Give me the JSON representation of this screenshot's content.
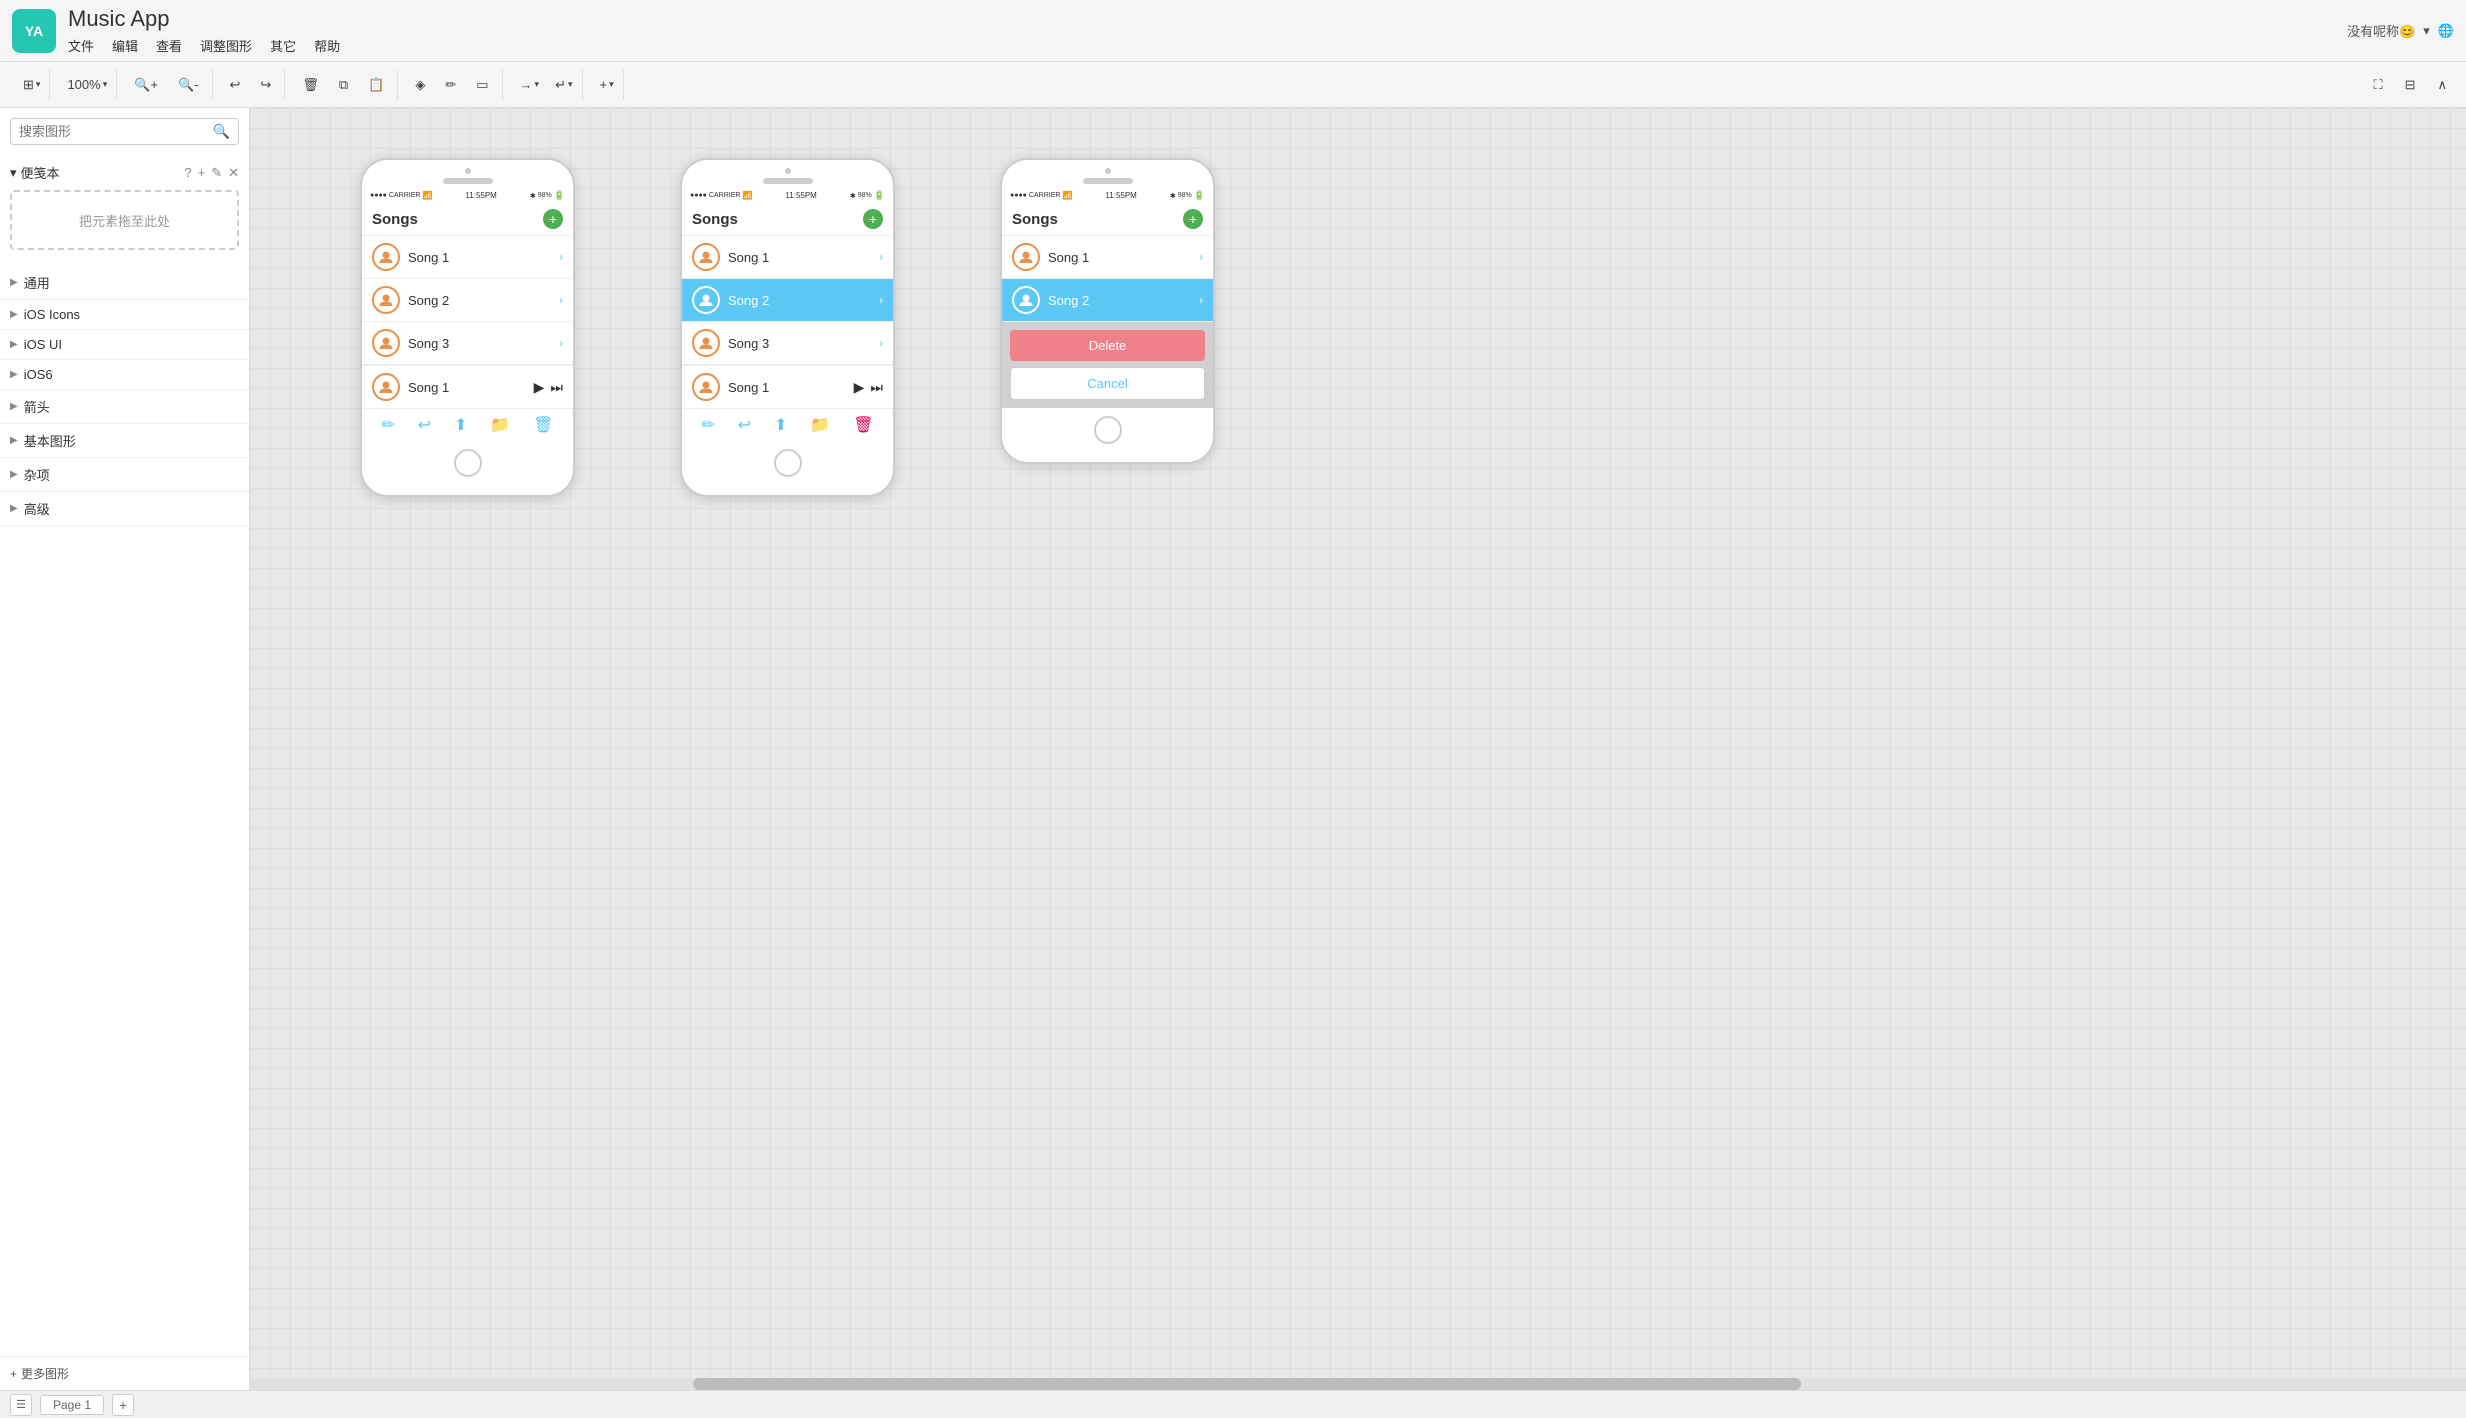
{
  "app": {
    "logo": "YA",
    "title": "Music App",
    "menu": [
      "文件",
      "编辑",
      "查看",
      "调整图形",
      "其它",
      "帮助"
    ],
    "top_right": "没有呢称😊"
  },
  "toolbar": {
    "zoom_level": "100%",
    "add_label": "+",
    "arrow_labels": [
      "→",
      "↵",
      "+"
    ]
  },
  "sidebar": {
    "search_placeholder": "搜索图形",
    "stencil_title": "便笺本",
    "drop_zone_text": "把元素拖至此处",
    "categories": [
      "通用",
      "iOS Icons",
      "iOS UI",
      "iOS6",
      "箭头",
      "基本图形",
      "杂项",
      "高级"
    ]
  },
  "phones": [
    {
      "id": "phone1",
      "status_left": "●●●● CARRIER",
      "status_wifi": "WiFi",
      "status_time": "11:55PM",
      "status_bt": "BT",
      "status_battery": "98%",
      "title": "Songs",
      "songs": [
        "Song 1",
        "Song 2",
        "Song 3"
      ],
      "now_playing": "Song 1",
      "selected_song": null,
      "show_actions": false
    },
    {
      "id": "phone2",
      "status_left": "●●●● CARRIER",
      "status_wifi": "WiFi",
      "status_time": "11:55PM",
      "status_bt": "BT",
      "status_battery": "98%",
      "title": "Songs",
      "songs": [
        "Song 1",
        "Song 2",
        "Song 3"
      ],
      "now_playing": "Song 1",
      "selected_song": "Song 2",
      "show_actions": false
    },
    {
      "id": "phone3",
      "status_left": "●●●● CARRIER",
      "status_wifi": "WiFi",
      "status_time": "11:55PM",
      "status_bt": "BT",
      "status_battery": "98%",
      "title": "Songs",
      "songs": [
        "Song 1",
        "Song 2"
      ],
      "now_playing": null,
      "selected_song": "Song 2",
      "show_actions": true,
      "delete_label": "Delete",
      "cancel_label": "Cancel"
    }
  ],
  "bottom_bar": {
    "page_label": "Page 1"
  }
}
